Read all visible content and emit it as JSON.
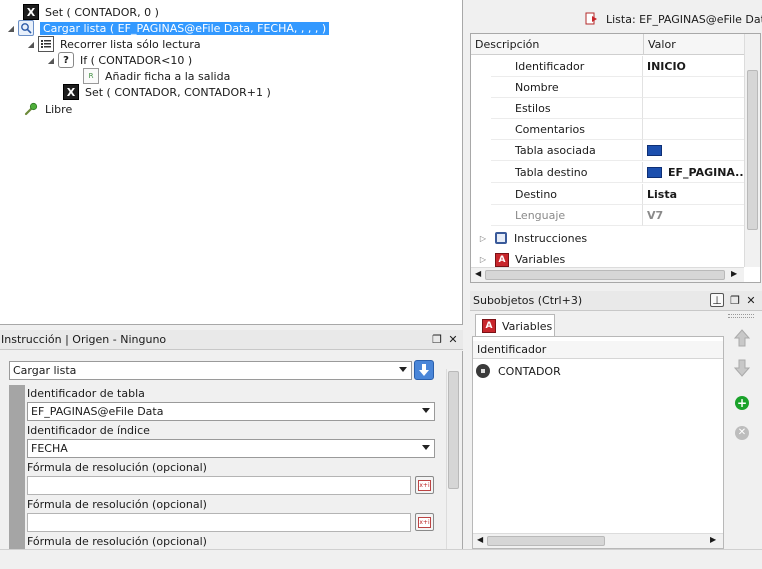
{
  "tree": {
    "rows": [
      {
        "label": "Set ( CONTADOR, 0 )"
      },
      {
        "label": "Cargar lista ( EF_PAGINAS@eFile Data, FECHA, , , ,  )"
      },
      {
        "label": "Recorrer lista sólo lectura"
      },
      {
        "label": "If ( CONTADOR<10 )"
      },
      {
        "label": "Añadir ficha a la salida"
      },
      {
        "label": "Set ( CONTADOR, CONTADOR+1 )"
      },
      {
        "label": "Libre"
      }
    ],
    "icon_glyphs": {
      "x": "X",
      "if": "?",
      "rec": "R"
    }
  },
  "instruction_panel": {
    "title": "Instrucción | Origen - Ninguno",
    "command_select": "Cargar lista",
    "table_id_label": "Identificador de tabla",
    "table_id_value": "EF_PAGINAS@eFile Data",
    "index_id_label": "Identificador de índice",
    "index_id_value": "FECHA",
    "formula_label": "Fórmula de resolución (opcional)",
    "formula_label_2": "Fórmula de resolución (opcional)",
    "formula_label_3": "Fórmula de resolución (opcional)",
    "formula_btn_glyph": "x+i"
  },
  "properties": {
    "caption": "Lista: EF_PAGINAS@eFile Data",
    "col_description": "Descripción",
    "col_value": "Valor",
    "rows": [
      {
        "name": "Identificador",
        "value": "INICIO"
      },
      {
        "name": "Nombre",
        "value": ""
      },
      {
        "name": "Estilos",
        "value": ""
      },
      {
        "name": "Comentarios",
        "value": ""
      },
      {
        "name": "Tabla asociada",
        "value": ""
      },
      {
        "name": "Tabla destino",
        "value": "EF_PAGINA..."
      },
      {
        "name": "Destino",
        "value": "Lista"
      },
      {
        "name": "Lenguaje",
        "value": "V7"
      }
    ],
    "groups": [
      {
        "label": "Instrucciones"
      },
      {
        "label": "Variables"
      }
    ]
  },
  "subobjects": {
    "title": "Subobjetos (Ctrl+3)",
    "tab_label": "Variables",
    "tab_icon_glyph": "A",
    "col_identifier": "Identificador",
    "items": [
      {
        "label": "CONTADOR"
      }
    ]
  },
  "colors": {
    "selection": "#3399ff",
    "folder": "#1c4fae",
    "variables_icon": "#c8262c",
    "add_button": "#1aa22a"
  }
}
